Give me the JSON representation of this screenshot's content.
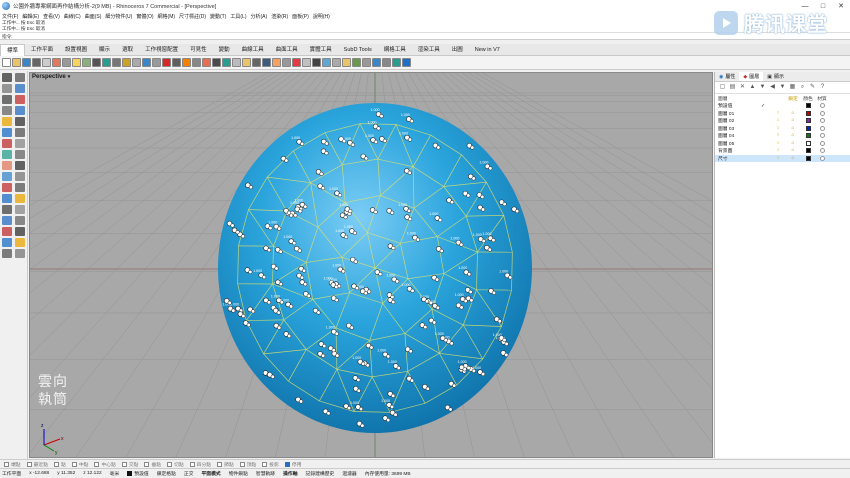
{
  "window": {
    "title": "公園外牆專案網面再作結構分析-2(9 MB) - Rhinoceros 7 Commercial - [Perspective]",
    "controls": [
      "—",
      "□",
      "✕"
    ]
  },
  "menu": [
    "文件(F)",
    "編輯(E)",
    "查看(V)",
    "曲線(C)",
    "曲面(S)",
    "細分物件(U)",
    "實體(O)",
    "網格(M)",
    "尺寸標註(D)",
    "變動(T)",
    "工具(L)",
    "分析(A)",
    "渲染(R)",
    "面板(P)",
    "說明(H)"
  ],
  "command_history": {
    "lines": [
      "工作中... 按 Esc 取消",
      "工作中... 按 Esc 取消",
      "工作中... 按 Esc 取消"
    ],
    "prompt": "指令:"
  },
  "watermark": {
    "text": "腾讯课堂",
    "color": "#b7d3ee"
  },
  "tabs": [
    "標準",
    "工作平面",
    "設置視圖",
    "顯示",
    "選取",
    "工作視窗配置",
    "可見性",
    "變動",
    "曲線工具",
    "曲面工具",
    "實體工具",
    "SubD Tools",
    "網格工具",
    "渲染工具",
    "出圖",
    "New in V7"
  ],
  "viewport": {
    "name": "Perspective",
    "dropdown_icon": "chevron-down-icon",
    "background": "#a8a8a8",
    "sphere_color": "#2aa4dc",
    "annotation_label": "1.000",
    "corner_logo": [
      "雲向",
      "執筒"
    ],
    "axes": {
      "x": "x",
      "y": "y",
      "z": "z"
    }
  },
  "right_panel": {
    "tabs": [
      {
        "label": "屬性",
        "icon": "properties-icon"
      },
      {
        "label": "圖層",
        "icon": "layers-icon"
      },
      {
        "label": "顯示",
        "icon": "display-icon"
      }
    ],
    "headers": {
      "name": "圖層",
      "current": "",
      "visible": "",
      "lock": "鎖定",
      "color": "顏色",
      "material": "材質"
    },
    "layers": [
      {
        "name": "預設值",
        "current": true,
        "visible": false,
        "locked": false,
        "color": "#000000",
        "selected": false
      },
      {
        "name": "圖層 01",
        "current": false,
        "visible": true,
        "locked": true,
        "color": "#c00000",
        "selected": false
      },
      {
        "name": "圖層 02",
        "current": false,
        "visible": true,
        "locked": true,
        "color": "#7d2aa8",
        "selected": false
      },
      {
        "name": "圖層 03",
        "current": false,
        "visible": true,
        "locked": true,
        "color": "#0022cc",
        "selected": false
      },
      {
        "name": "圖層 04",
        "current": false,
        "visible": true,
        "locked": true,
        "color": "#0e7a1a",
        "selected": false
      },
      {
        "name": "圖層 05",
        "current": false,
        "visible": true,
        "locked": true,
        "color": "#ffffff",
        "selected": false
      },
      {
        "name": "背景圖",
        "current": false,
        "visible": true,
        "locked": true,
        "color": "#000000",
        "selected": false
      },
      {
        "name": "尺寸",
        "current": false,
        "visible": true,
        "locked": true,
        "color": "#000000",
        "selected": true
      }
    ]
  },
  "osnap": [
    {
      "label": "端點",
      "on": false
    },
    {
      "label": "最近點",
      "on": false
    },
    {
      "label": "點",
      "on": false
    },
    {
      "label": "中點",
      "on": false
    },
    {
      "label": "中心點",
      "on": false
    },
    {
      "label": "交點",
      "on": false
    },
    {
      "label": "垂點",
      "on": false
    },
    {
      "label": "切點",
      "on": false
    },
    {
      "label": "四分點",
      "on": false
    },
    {
      "label": "節點",
      "on": false
    },
    {
      "label": "頂點",
      "on": false
    },
    {
      "label": "投影",
      "on": false
    },
    {
      "label": "停用",
      "on": true
    }
  ],
  "status": {
    "cplane": "工作平面",
    "x": "x -12.688",
    "y": "y 11.352",
    "z": "z 12.122",
    "unit": "毫米",
    "layer": "預設值",
    "toggles": [
      "鎖定格點",
      "正交",
      "平面模式",
      "物件鎖點",
      "智慧軌跡",
      "操作軸",
      "記錄建構歷史",
      "過濾器",
      "內存使用量: 3699 MB"
    ],
    "bold_toggles": [
      "平面模式",
      "操作軸"
    ]
  }
}
